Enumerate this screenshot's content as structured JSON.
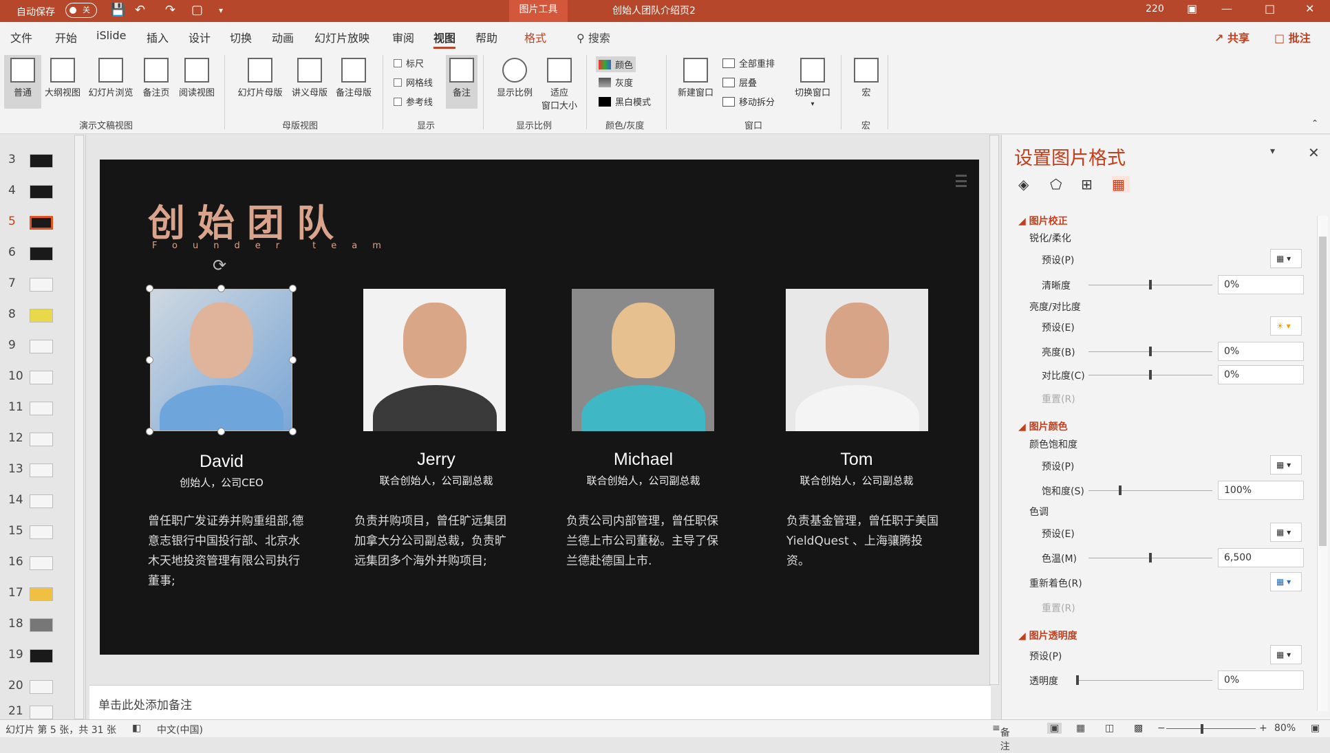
{
  "titlebar": {
    "autosave_label": "自动保存",
    "autosave_state": "关",
    "tool_tab": "图片工具",
    "doc_title": "创始人团队介绍页2",
    "user": "220"
  },
  "tabs": [
    "文件",
    "开始",
    "iSlide",
    "插入",
    "设计",
    "切换",
    "动画",
    "幻灯片放映",
    "审阅",
    "视图",
    "帮助",
    "格式"
  ],
  "active_tab": "视图",
  "search_label": "搜索",
  "share_label": "共享",
  "comments_label": "批注",
  "ribbon": {
    "presentation_views": [
      "普通",
      "大纲视图",
      "幻灯片浏览",
      "备注页",
      "阅读视图"
    ],
    "presentation_group": "演示文稿视图",
    "master_views": [
      "幻灯片母版",
      "讲义母版",
      "备注母版"
    ],
    "master_group": "母版视图",
    "show_items": [
      "标尺",
      "网格线",
      "参考线"
    ],
    "notes_btn": "备注",
    "show_group": "显示",
    "zoom_btn": "显示比例",
    "fit_btn_line1": "适应",
    "fit_btn_line2": "窗口大小",
    "zoom_group": "显示比例",
    "color_items": [
      "颜色",
      "灰度",
      "黑白模式"
    ],
    "color_group": "颜色/灰度",
    "new_window": "新建窗口",
    "window_items": [
      "全部重排",
      "层叠",
      "移动拆分"
    ],
    "switch_window": "切换窗口",
    "window_group": "窗口",
    "macro": "宏",
    "macro_group": "宏"
  },
  "thumbnails": [
    "3",
    "4",
    "5",
    "6",
    "7",
    "8",
    "9",
    "10",
    "11",
    "12",
    "13",
    "14",
    "15",
    "16",
    "17",
    "18",
    "19",
    "20",
    "21"
  ],
  "current_slide": "5",
  "slide": {
    "title": "创始团队",
    "subtitle": "Founder team",
    "people": [
      {
        "name": "David",
        "role": "创始人，公司CEO",
        "desc": "曾任职广发证券并购重组部,德意志银行中国投行部、北京水木天地投资管理有限公司执行董事;"
      },
      {
        "name": "Jerry",
        "role": "联合创始人，公司副总裁",
        "desc": "负责并购项目，曾任旷远集团加拿大分公司副总裁，负责旷远集团多个海外并购项目;"
      },
      {
        "name": "Michael",
        "role": "联合创始人，公司副总裁",
        "desc": "负责公司内部管理，曾任职保兰德上市公司董秘。主导了保兰德赴德国上市."
      },
      {
        "name": "Tom",
        "role": "联合创始人，公司副总裁",
        "desc": "负责基金管理，曾任职于美国YieldQuest 、上海骧腾投资。"
      }
    ]
  },
  "notes_placeholder": "单击此处添加备注",
  "panel": {
    "title": "设置图片格式",
    "sec1": "图片校正",
    "sharpen": "锐化/柔化",
    "preset_p": "预设(P)",
    "clarity": "清晰度",
    "clarity_val": "0%",
    "brightness_contrast": "亮度/对比度",
    "preset_e": "预设(E)",
    "brightness": "亮度(B)",
    "brightness_val": "0%",
    "contrast": "对比度(C)",
    "contrast_val": "0%",
    "reset_r": "重置(R)",
    "sec2": "图片颜色",
    "saturation_group": "颜色饱和度",
    "saturation": "饱和度(S)",
    "saturation_val": "100%",
    "tone": "色调",
    "temp": "色温(M)",
    "temp_val": "6,500",
    "recolor": "重新着色(R)",
    "sec3": "图片透明度",
    "transparency": "透明度",
    "transparency_val": "0%"
  },
  "status": {
    "slide_info": "幻灯片 第 5 张，共 31 张",
    "language": "中文(中国)",
    "notes": "备注",
    "zoom": "80%"
  }
}
